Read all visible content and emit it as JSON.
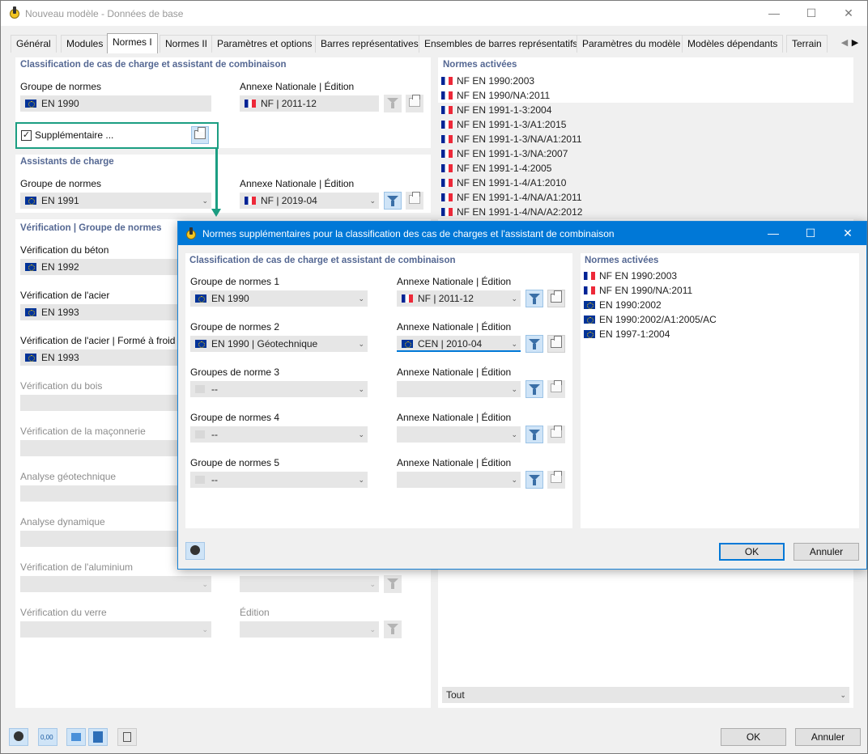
{
  "main": {
    "title": "Nouveau modèle - Données de base",
    "tabs": [
      "Général",
      "Modules",
      "Normes I",
      "Normes II",
      "Paramètres et options",
      "Barres représentatives",
      "Ensembles de barres représentatifs",
      "Paramètres du modèle",
      "Modèles dépendants",
      "Terrain"
    ],
    "classification": {
      "header": "Classification de cas de charge et assistant de combinaison",
      "group_label": "Groupe de normes",
      "group_value": "EN 1990",
      "annex_label": "Annexe Nationale | Édition",
      "annex_value": "NF | 2011-12",
      "supplementary_label": "Supplémentaire ..."
    },
    "load_wizards": {
      "header": "Assistants de charge",
      "group_label": "Groupe de normes",
      "group_value": "EN 1991",
      "annex_label": "Annexe Nationale | Édition",
      "annex_value": "NF | 2019-04"
    },
    "verification": {
      "header": "Vérification | Groupe de normes",
      "concrete_label": "Vérification du béton",
      "concrete_value": "EN 1992",
      "steel_label": "Vérification de l'acier",
      "steel_value": "EN 1993",
      "coldformed_label": "Vérification de l'acier | Formé à froid",
      "coldformed_value": "EN 1993",
      "timber_label": "Vérification du bois",
      "masonry_label": "Vérification de la maçonnerie",
      "geotech_label": "Analyse géotechnique",
      "dynamic_label": "Analyse dynamique",
      "aluminium_label": "Vérification de l'aluminium",
      "glass_label": "Vérification du verre",
      "edition_label": "Édition"
    },
    "activated": {
      "header": "Normes activées",
      "items": [
        "NF EN 1990:2003",
        "NF EN 1990/NA:2011",
        "NF EN 1991-1-3:2004",
        "NF EN 1991-1-3/A1:2015",
        "NF EN 1991-1-3/NA/A1:2011",
        "NF EN 1991-1-3/NA:2007",
        "NF EN 1991-1-4:2005",
        "NF EN 1991-1-4/A1:2010",
        "NF EN 1991-1-4/NA/A1:2011",
        "NF EN 1991-1-4/NA/A2:2012"
      ],
      "filter_value": "Tout"
    },
    "ok_label": "OK",
    "cancel_label": "Annuler"
  },
  "dialog": {
    "title": "Normes supplémentaires pour la classification des cas de charges et l'assistant de combinaison",
    "header": "Classification de cas de charge et assistant de combinaison",
    "rows": [
      {
        "group_label": "Groupe de normes 1",
        "group_value": "EN 1990",
        "annex_label": "Annexe Nationale | Édition",
        "annex_value": "NF | 2011-12"
      },
      {
        "group_label": "Groupe de normes 2",
        "group_value": "EN 1990 | Géotechnique",
        "annex_label": "Annexe Nationale | Édition",
        "annex_value": "CEN | 2010-04"
      },
      {
        "group_label": "Groupes de norme 3",
        "group_value": "--",
        "annex_label": "Annexe Nationale | Édition",
        "annex_value": ""
      },
      {
        "group_label": "Groupe de normes 4",
        "group_value": "--",
        "annex_label": "Annexe Nationale | Édition",
        "annex_value": ""
      },
      {
        "group_label": "Groupe de normes 5",
        "group_value": "--",
        "annex_label": "Annexe Nationale | Édition",
        "annex_value": ""
      }
    ],
    "activated_header": "Normes activées",
    "activated_items": [
      "NF EN 1990:2003",
      "NF EN 1990/NA:2011",
      "EN 1990:2002",
      "EN 1990:2002/A1:2005/AC",
      "EN 1997-1:2004"
    ],
    "ok_label": "OK",
    "cancel_label": "Annuler"
  },
  "colors": {
    "accent": "#0078d7",
    "highlight": "#1b9e82",
    "section_header": "#556893"
  }
}
